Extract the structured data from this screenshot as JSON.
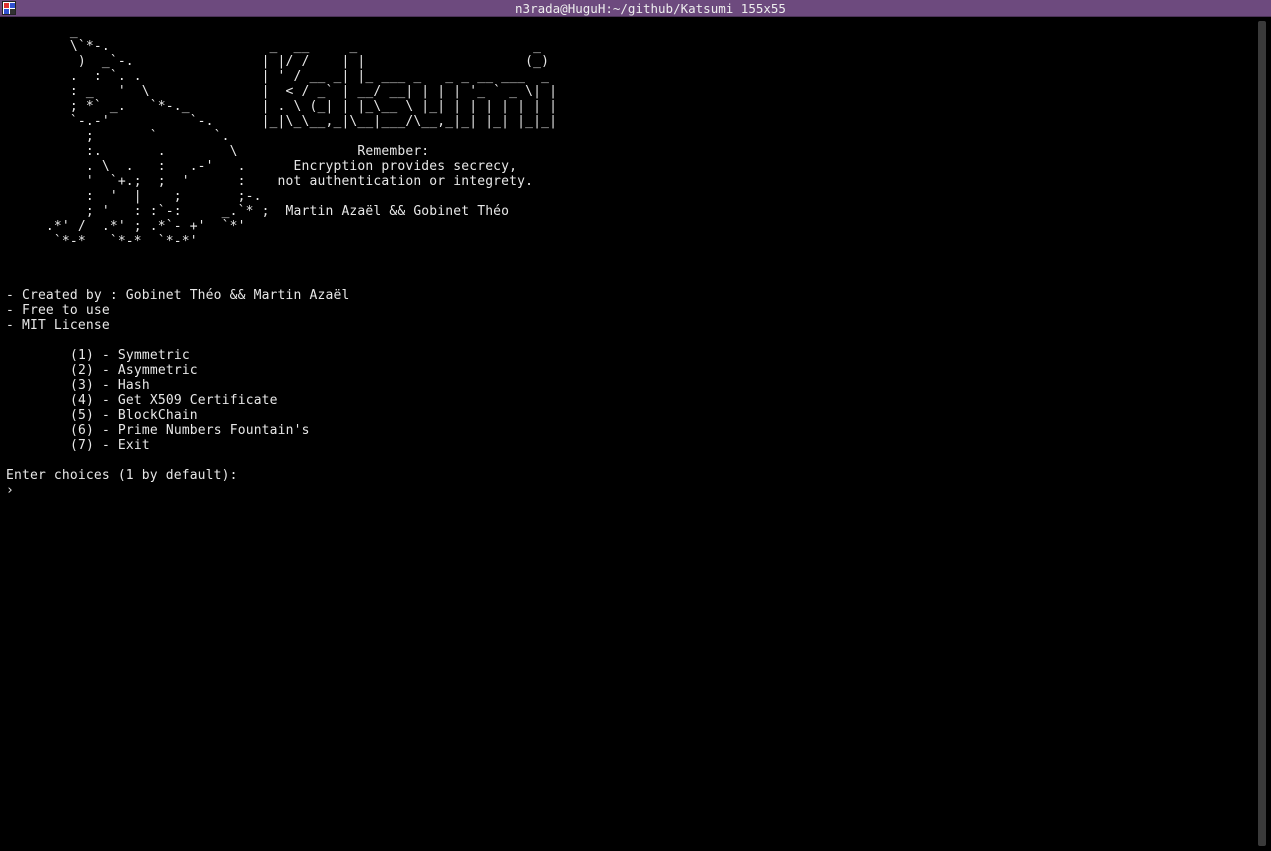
{
  "window": {
    "title": "n3rada@HuguH:~/github/Katsumi 155x55",
    "icon": "terminal-app-icon"
  },
  "terminal": {
    "banner_art": "        _\n        \\`*-.                    _  __     _                      _\n         )  _`-.                | |/ /    | |                    (_)\n        .  : `. .               | ' / __ _| |_ ___ _   _ _ __ ___  _\n        : _   '  \\              |  < / _` | __/ __| | | | '_ ` _ \\| |\n        ; *` _.   `*-._         | . \\ (_| | |_\\__ \\ |_| | | | | | | |\n        `-.-'          `-.      |_|\\_\\__,_|\\__|___/\\__,_|_| |_| |_|_|\n          ;       `       `.\n          :.       .        \\               Remember:\n          . \\  .   :   .-'   .      Encryption provides secrecy,\n          '  `+.;  ;  '      :    not authentication or integrety.\n          :  '  |    ;       ;-.\n          ; '   : :`-:     _.`* ;  Martin Azaël && Gobinet Théo\n     .*' /  .*' ; .*`- +'  `*'\n      `*-*   `*-*  `*-*'",
    "credits": [
      "- Created by : Gobinet Théo && Martin Azaël",
      "- Free to use",
      "- MIT License"
    ],
    "menu": [
      "(1) - Symmetric",
      "(2) - Asymmetric",
      "(3) - Hash",
      "(4) - Get X509 Certificate",
      "(5) - BlockChain",
      "(6) - Prime Numbers Fountain's",
      "(7) - Exit"
    ],
    "prompt": "Enter choices (1 by default):",
    "cursor": "›"
  },
  "colors": {
    "titlebar": "#6d4a7e",
    "background": "#000000",
    "text": "#e8e8e8"
  }
}
